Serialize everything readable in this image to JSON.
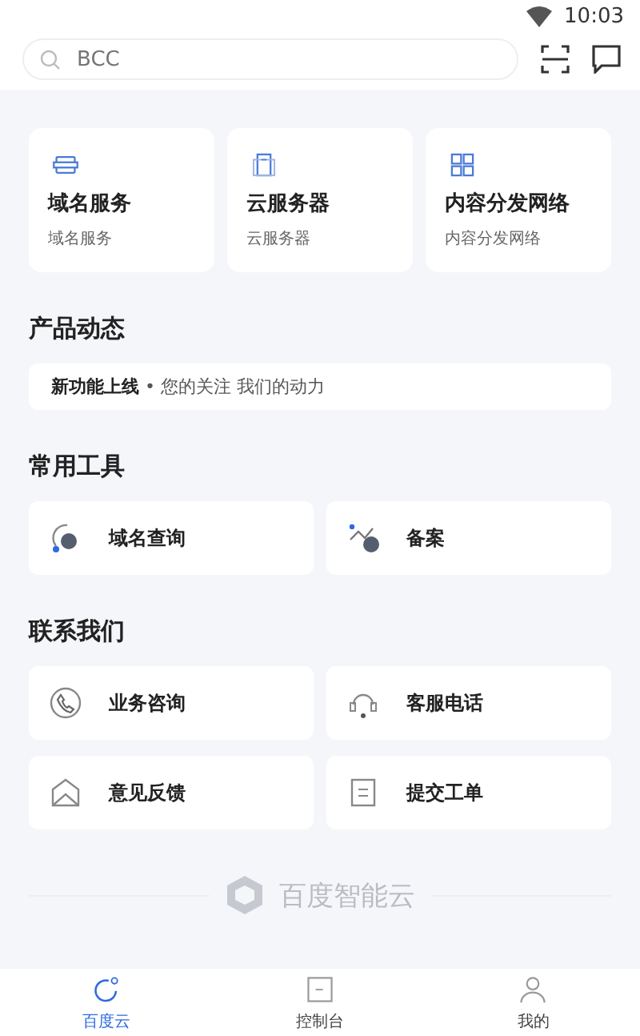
{
  "status_bar": {
    "time": "10:03"
  },
  "search": {
    "placeholder": "BCC"
  },
  "products": [
    {
      "title": "域名服务",
      "subtitle": "域名服务",
      "kind": "domain"
    },
    {
      "title": "云服务器",
      "subtitle": "云服务器",
      "kind": "server"
    },
    {
      "title": "内容分发网络",
      "subtitle": "内容分发网络",
      "kind": "cdn"
    }
  ],
  "news": {
    "title": "产品动态",
    "headline": "新功能上线",
    "separator": "•",
    "text": "您的关注 我们的动力"
  },
  "tools": {
    "title": "常用工具",
    "items": [
      {
        "label": "域名查询",
        "kind": "lookup"
      },
      {
        "label": "备案",
        "kind": "filing"
      }
    ]
  },
  "contact": {
    "title": "联系我们",
    "items": [
      {
        "label": "业务咨询",
        "kind": "phone"
      },
      {
        "label": "客服电话",
        "kind": "headset"
      },
      {
        "label": "意见反馈",
        "kind": "mail"
      },
      {
        "label": "提交工单",
        "kind": "ticket"
      }
    ]
  },
  "footer_logo": {
    "name": "百度智能云"
  },
  "tabs": [
    {
      "label": "百度云",
      "kind": "home",
      "selected": true
    },
    {
      "label": "控制台",
      "kind": "console",
      "selected": false
    },
    {
      "label": "我的",
      "kind": "me",
      "selected": false
    }
  ]
}
